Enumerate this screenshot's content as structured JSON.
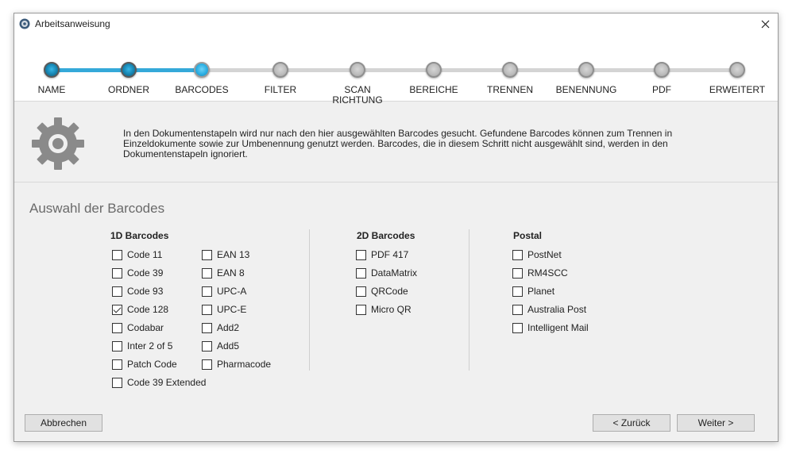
{
  "window": {
    "title": "Arbeitsanweisung"
  },
  "steps": [
    {
      "label": "NAME",
      "state": "done"
    },
    {
      "label": "ORDNER",
      "state": "done"
    },
    {
      "label": "BARCODES",
      "state": "active"
    },
    {
      "label": "FILTER",
      "state": "todo"
    },
    {
      "label": "SCAN\nRICHTUNG",
      "state": "todo"
    },
    {
      "label": "BEREICHE",
      "state": "todo"
    },
    {
      "label": "TRENNEN",
      "state": "todo"
    },
    {
      "label": "BENENNUNG",
      "state": "todo"
    },
    {
      "label": "PDF",
      "state": "todo"
    },
    {
      "label": "ERWEITERT",
      "state": "todo"
    }
  ],
  "info": {
    "text": "In den Dokumentenstapeln wird nur nach den hier ausgewählten Barcodes gesucht. Gefundene Barcodes können zum Trennen in Einzeldokumente sowie zur Umbenennung genutzt werden. Barcodes, die in diesem Schritt nicht ausgewählt sind, werden in den Dokumentenstapeln ignoriert."
  },
  "section": {
    "title": "Auswahl der Barcodes"
  },
  "groups": {
    "oned": {
      "title": "1D Barcodes",
      "col1": [
        {
          "label": "Code 11",
          "checked": false
        },
        {
          "label": "Code 39",
          "checked": false
        },
        {
          "label": "Code 93",
          "checked": false
        },
        {
          "label": "Code 128",
          "checked": true
        },
        {
          "label": "Codabar",
          "checked": false
        },
        {
          "label": "Inter 2 of 5",
          "checked": false
        },
        {
          "label": "Patch Code",
          "checked": false
        },
        {
          "label": "Code 39 Extended",
          "checked": false
        }
      ],
      "col2": [
        {
          "label": "EAN 13",
          "checked": false
        },
        {
          "label": "EAN 8",
          "checked": false
        },
        {
          "label": "UPC-A",
          "checked": false
        },
        {
          "label": "UPC-E",
          "checked": false
        },
        {
          "label": "Add2",
          "checked": false
        },
        {
          "label": "Add5",
          "checked": false
        },
        {
          "label": "Pharmacode",
          "checked": false
        }
      ]
    },
    "twod": {
      "title": "2D Barcodes",
      "items": [
        {
          "label": "PDF 417",
          "checked": false
        },
        {
          "label": "DataMatrix",
          "checked": false
        },
        {
          "label": "QRCode",
          "checked": false
        },
        {
          "label": "Micro QR",
          "checked": false
        }
      ]
    },
    "postal": {
      "title": "Postal",
      "items": [
        {
          "label": "PostNet",
          "checked": false
        },
        {
          "label": "RM4SCC",
          "checked": false
        },
        {
          "label": "Planet",
          "checked": false
        },
        {
          "label": "Australia Post",
          "checked": false
        },
        {
          "label": "Intelligent Mail",
          "checked": false
        }
      ]
    }
  },
  "buttons": {
    "cancel": "Abbrechen",
    "back": "< Zurück",
    "next": "Weiter >"
  },
  "icons": {
    "app": "app-gear-icon",
    "close": "close-icon",
    "settings": "gear-icon"
  },
  "colors": {
    "accent": "#35a9d9",
    "inactive": "#d4d4d4"
  }
}
